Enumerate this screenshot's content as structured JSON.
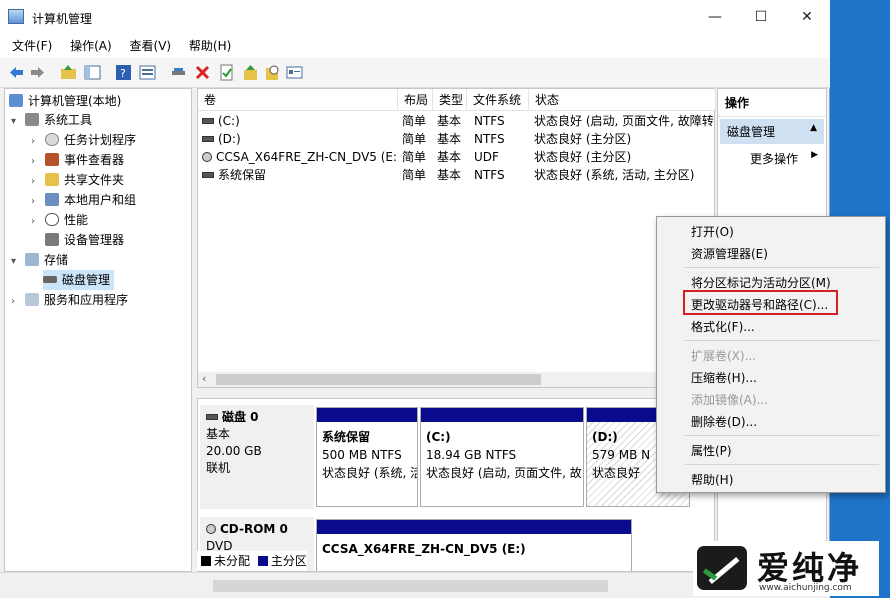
{
  "window": {
    "title": "计算机管理",
    "controls": [
      "—",
      "☐",
      "✕"
    ]
  },
  "menu": [
    "文件(F)",
    "操作(A)",
    "查看(V)",
    "帮助(H)"
  ],
  "tree": {
    "root": "计算机管理(本地)",
    "system_tools": "系统工具",
    "task_scheduler": "任务计划程序",
    "event_viewer": "事件查看器",
    "shared_folders": "共享文件夹",
    "local_users": "本地用户和组",
    "performance": "性能",
    "device_manager": "设备管理器",
    "storage": "存储",
    "disk_management": "磁盘管理",
    "services_apps": "服务和应用程序"
  },
  "volume_table": {
    "headers": [
      "卷",
      "布局",
      "类型",
      "文件系统",
      "状态"
    ],
    "rows": [
      {
        "vol": "(C:)",
        "layout": "简单",
        "type": "基本",
        "fs": "NTFS",
        "status": "状态良好 (启动, 页面文件, 故障转"
      },
      {
        "vol": "(D:)",
        "layout": "简单",
        "type": "基本",
        "fs": "NTFS",
        "status": "状态良好 (主分区)"
      },
      {
        "vol": "CCSA_X64FRE_ZH-CN_DV5 (E:)",
        "layout": "简单",
        "type": "基本",
        "fs": "UDF",
        "status": "状态良好 (主分区)"
      },
      {
        "vol": "系统保留",
        "layout": "简单",
        "type": "基本",
        "fs": "NTFS",
        "status": "状态良好 (系统, 活动, 主分区)"
      }
    ]
  },
  "disk0": {
    "name": "磁盘 0",
    "kind": "基本",
    "size": "20.00 GB",
    "state": "联机",
    "partitions": [
      {
        "name": "系统保留",
        "size": "500 MB NTFS",
        "status": "状态良好 (系统, 活"
      },
      {
        "name": "(C:)",
        "size": "18.94 GB NTFS",
        "status": "状态良好 (启动, 页面文件, 故"
      },
      {
        "name": "(D:)",
        "size": "579 MB N",
        "status": "状态良好"
      }
    ]
  },
  "cdrom0": {
    "name": "CD-ROM 0",
    "kind": "DVD",
    "partition": "CCSA_X64FRE_ZH-CN_DV5 (E:)"
  },
  "legend": {
    "unallocated": "未分配",
    "primary": "主分区"
  },
  "actions": {
    "header": "操作",
    "section": "磁盘管理",
    "more": "更多操作"
  },
  "context_menu": {
    "open": "打开(O)",
    "explorer": "资源管理器(E)",
    "mark_active": "将分区标记为活动分区(M)",
    "change_letter": "更改驱动器号和路径(C)...",
    "format": "格式化(F)...",
    "extend": "扩展卷(X)...",
    "shrink": "压缩卷(H)...",
    "add_mirror": "添加镜像(A)...",
    "delete": "删除卷(D)...",
    "properties": "属性(P)",
    "help": "帮助(H)"
  },
  "watermark": {
    "brand": "爱纯净",
    "url": "www.aichunjing.com"
  },
  "colors": {
    "primary_partition": "#0a0a8c",
    "highlight": "#d42020",
    "desktop": "#1e74c8"
  }
}
